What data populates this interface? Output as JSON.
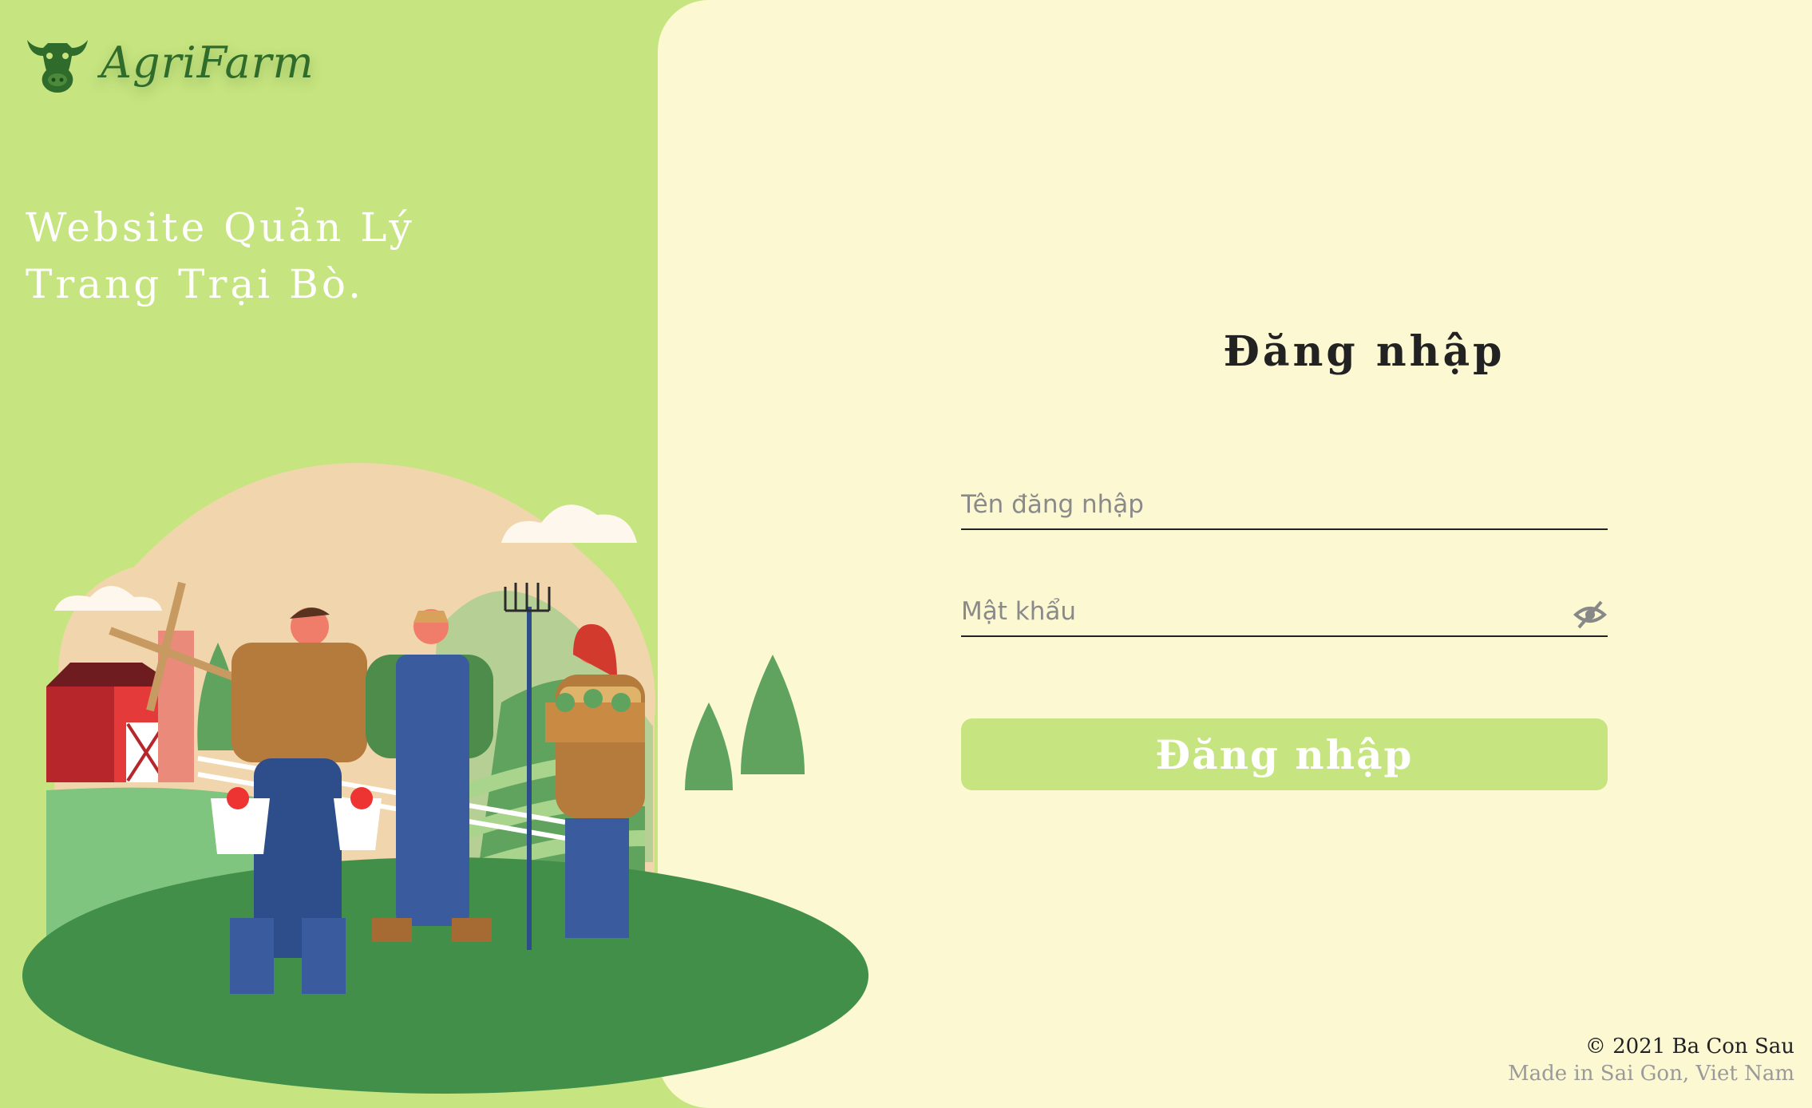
{
  "brand": {
    "name": "AgriFarm",
    "logo_icon": "cow-head-icon"
  },
  "tagline": "Website Quản Lý Trang Trại Bò.",
  "login": {
    "title": "Đăng nhập",
    "username_placeholder": "Tên đăng nhập",
    "password_placeholder": "Mật khẩu",
    "password_toggle_icon": "eye-off-icon",
    "submit_label": "Đăng nhập"
  },
  "footer": {
    "copyright": "© 2021 Ba Con Sau",
    "made_in": "Made in Sai Gon, Viet Nam"
  },
  "colors": {
    "brand_green": "#c6e47f",
    "panel_bg": "#fbf8d2",
    "logo_green": "#2f6b2a",
    "field_green": "#418f49"
  }
}
